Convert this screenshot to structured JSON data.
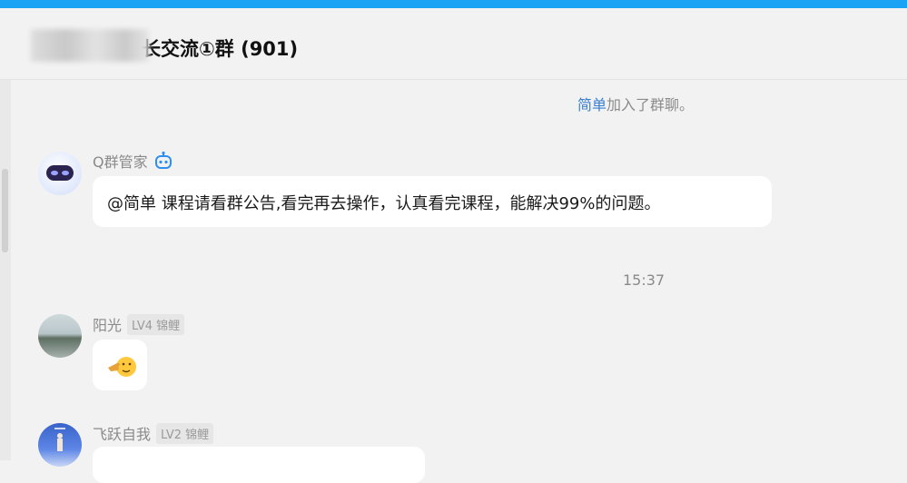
{
  "header": {
    "title": "长交流①群 (901)"
  },
  "system_message": {
    "name": "简单",
    "text": "加入了群聊。"
  },
  "timestamp": "15:37",
  "messages": [
    {
      "sender": "Q群管家",
      "icon": "robot-icon",
      "text": "@简单   课程请看群公告,看完再去操作，认真看完课程，能解决99%的问题。"
    },
    {
      "sender": "阳光",
      "level": "LV4 锦鲤",
      "icon": "pointing-emoji-icon"
    },
    {
      "sender": "飞跃自我",
      "level": "LV2 锦鲤"
    }
  ],
  "colors": {
    "accent": "#1aa3f5",
    "link": "#3b7fd1"
  }
}
